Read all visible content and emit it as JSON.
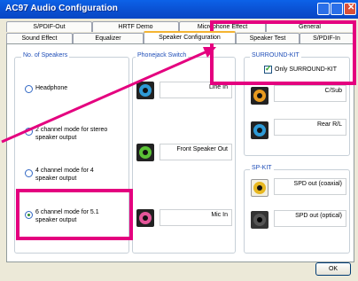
{
  "window": {
    "title": "AC97 Audio Configuration"
  },
  "tabs": {
    "row1": [
      "S/PDIF-Out",
      "HRTF Demo",
      "Microphone Effect",
      "General"
    ],
    "row2": [
      "Sound Effect",
      "Equalizer",
      "Speaker Configuration",
      "Speaker Test",
      "S/PDIF-In"
    ],
    "selected": "Speaker Configuration"
  },
  "speakers": {
    "title": "No. of Speakers",
    "options": [
      {
        "label": "Headphone",
        "selected": false
      },
      {
        "label": "2 channel mode for stereo speaker output",
        "selected": false
      },
      {
        "label": "4 channel mode for 4 speaker output",
        "selected": false
      },
      {
        "label": "6 channel mode for 5.1 speaker output",
        "selected": true
      }
    ]
  },
  "phonejack": {
    "title": "Phonejack Switch",
    "jacks": [
      {
        "label": "Line In",
        "color": "#2e9ad6"
      },
      {
        "label": "Front Speaker Out",
        "color": "#5bc236"
      },
      {
        "label": "Mic In",
        "color": "#e4569a"
      }
    ]
  },
  "surround": {
    "title": "SURROUND-KIT",
    "checkbox_label": "Only SURROUND-KIT",
    "checked": true,
    "jacks": [
      {
        "label": "C/Sub",
        "color": "#e89a1f"
      },
      {
        "label": "Rear R/L",
        "color": "#2e9ad6"
      }
    ]
  },
  "spkit": {
    "title": "SP-KIT",
    "jacks": [
      {
        "label": "SPD out (coaxial)",
        "color": "#e8b820"
      },
      {
        "label": "SPD out (optical)",
        "color": "#333333"
      }
    ]
  },
  "ok_label": "OK",
  "colors": {
    "title_bar": "#0a50d2",
    "highlight": "#e4007f",
    "tab_accent": "#f4b432"
  }
}
